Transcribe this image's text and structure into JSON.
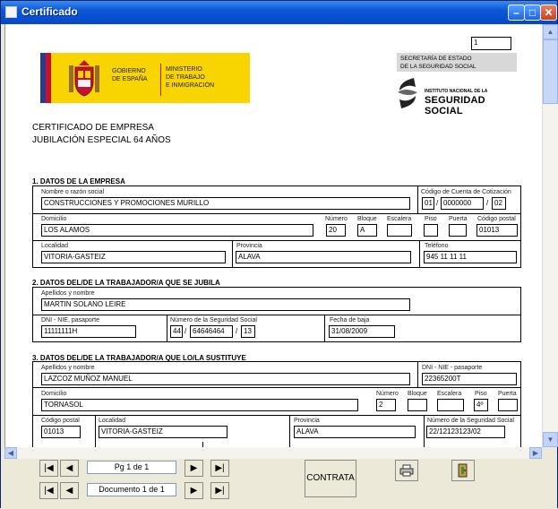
{
  "window": {
    "title": "Certificado"
  },
  "page_number_field": "1",
  "header": {
    "gob_line1": "GOBIERNO",
    "gob_line2": "DE ESPAÑA",
    "min_line1": "MINISTERIO",
    "min_line2": "DE TRABAJO",
    "min_line3": "E INMIGRACIÓN",
    "sec_line1": "SECRETARÍA DE ESTADO",
    "sec_line2": "DE LA SEGURIDAD SOCIAL",
    "inss_small": "INSTITUTO NACIONAL DE LA",
    "inss_big": "SEGURIDAD SOCIAL"
  },
  "doc_title1": "CERTIFICADO DE EMPRESA",
  "doc_title2": "JUBILACIÓN ESPECIAL 64 AÑOS",
  "s1": {
    "title": "1. DATOS DE LA EMPRESA",
    "lbl_nombre": "Nombre o razón social",
    "nombre": "CONSTRUCCIONES Y PROMOCIONES MURILLO",
    "lbl_ccc": "Código de Cuenta de Cotización",
    "ccc1": "01",
    "ccc2": "0000000",
    "ccc3": "02",
    "lbl_domicilio": "Domicilio",
    "domicilio": "LOS ALAMOS",
    "lbl_numero": "Número",
    "numero": "20",
    "lbl_bloque": "Bloque",
    "bloque": "A",
    "lbl_escalera": "Escalera",
    "lbl_piso": "Piso",
    "lbl_puerta": "Puerta",
    "lbl_cp": "Código postal",
    "cp": "01013",
    "lbl_localidad": "Localidad",
    "localidad": "VITORIA-GASTEIZ",
    "lbl_provincia": "Provincia",
    "provincia": "ALAVA",
    "lbl_telefono": "Teléfono",
    "telefono": "945 11 11 11"
  },
  "s2": {
    "title": "2. DATOS DEL/DE LA TRABAJADOR/A QUE SE JUBILA",
    "lbl_apellidos": "Apellidos y nombre",
    "apellidos": "MARTIN SOLANO LEIRE",
    "lbl_dni": "DNI - NIE, pasaporte",
    "dni": "11111111H",
    "lbl_nss": "Número de la Seguridad Social",
    "nss1": "44",
    "nss2": "64646464",
    "nss3": "13",
    "lbl_fecha": "Fecha de baja",
    "fecha": "31/08/2009"
  },
  "s3": {
    "title": "3. DATOS DEL/DE LA TRABAJADOR/A QUE LO/LA SUSTITUYE",
    "lbl_apellidos": "Apellidos y nombre",
    "apellidos": "LAZCOZ MUÑOZ MANUEL",
    "lbl_dni": "DNI - NIE - pasaporte",
    "dni": "22365200T",
    "lbl_domicilio": "Domicilio",
    "domicilio": "TORNASOL",
    "lbl_numero": "Número",
    "numero": "2",
    "lbl_bloque": "Bloque",
    "lbl_escalera": "Escalera",
    "lbl_piso": "Piso",
    "piso": "4º",
    "lbl_puerta": "Puerta",
    "lbl_cp": "Código postal",
    "cp": "01013",
    "lbl_localidad": "Localidad",
    "localidad": "VITORIA-GASTEIZ",
    "lbl_provincia": "Provincia",
    "provincia": "ALAVA",
    "lbl_nss": "Número de la Seguridad Social",
    "nss": "22/12123123/02"
  },
  "nav": {
    "page_label": "Pg 1 de 1",
    "doc_label": "Documento 1 de 1",
    "contrata": "CONTRATA"
  }
}
